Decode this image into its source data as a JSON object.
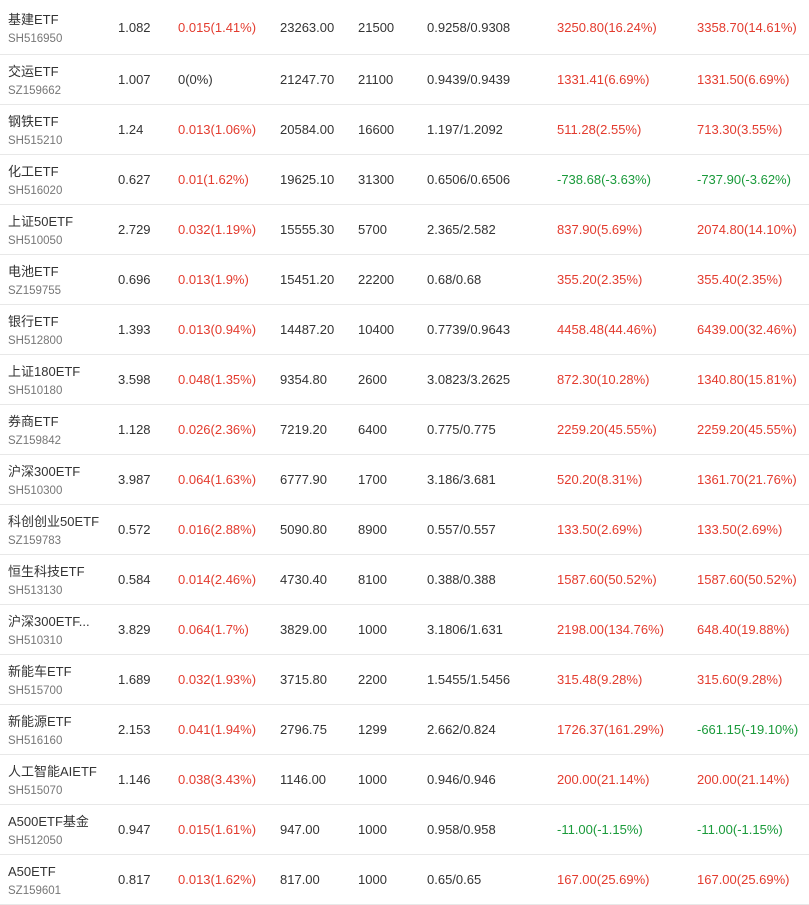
{
  "colors": {
    "up": "#e33b2e",
    "down": "#1a9a3a",
    "flat": "#333333"
  },
  "rows": [
    {
      "name": "基建ETF",
      "code": "SH516950",
      "price": "1.082",
      "change": "0.015(1.41%)",
      "change_dir": "up",
      "market_value": "23263.00",
      "qty": "21500",
      "cost": "0.9258/0.9308",
      "pnl1": "3250.80(16.24%)",
      "pnl1_dir": "up",
      "pnl2": "3358.70(14.61%)",
      "pnl2_dir": "up"
    },
    {
      "name": "交运ETF",
      "code": "SZ159662",
      "price": "1.007",
      "change": "0(0%)",
      "change_dir": "flat",
      "market_value": "21247.70",
      "qty": "21100",
      "cost": "0.9439/0.9439",
      "pnl1": "1331.41(6.69%)",
      "pnl1_dir": "up",
      "pnl2": "1331.50(6.69%)",
      "pnl2_dir": "up"
    },
    {
      "name": "钢铁ETF",
      "code": "SH515210",
      "price": "1.24",
      "change": "0.013(1.06%)",
      "change_dir": "up",
      "market_value": "20584.00",
      "qty": "16600",
      "cost": "1.197/1.2092",
      "pnl1": "511.28(2.55%)",
      "pnl1_dir": "up",
      "pnl2": "713.30(3.55%)",
      "pnl2_dir": "up"
    },
    {
      "name": "化工ETF",
      "code": "SH516020",
      "price": "0.627",
      "change": "0.01(1.62%)",
      "change_dir": "up",
      "market_value": "19625.10",
      "qty": "31300",
      "cost": "0.6506/0.6506",
      "pnl1": "-738.68(-3.63%)",
      "pnl1_dir": "down",
      "pnl2": "-737.90(-3.62%)",
      "pnl2_dir": "down"
    },
    {
      "name": "上证50ETF",
      "code": "SH510050",
      "price": "2.729",
      "change": "0.032(1.19%)",
      "change_dir": "up",
      "market_value": "15555.30",
      "qty": "5700",
      "cost": "2.365/2.582",
      "pnl1": "837.90(5.69%)",
      "pnl1_dir": "up",
      "pnl2": "2074.80(14.10%)",
      "pnl2_dir": "up"
    },
    {
      "name": "电池ETF",
      "code": "SZ159755",
      "price": "0.696",
      "change": "0.013(1.9%)",
      "change_dir": "up",
      "market_value": "15451.20",
      "qty": "22200",
      "cost": "0.68/0.68",
      "pnl1": "355.20(2.35%)",
      "pnl1_dir": "up",
      "pnl2": "355.40(2.35%)",
      "pnl2_dir": "up"
    },
    {
      "name": "银行ETF",
      "code": "SH512800",
      "price": "1.393",
      "change": "0.013(0.94%)",
      "change_dir": "up",
      "market_value": "14487.20",
      "qty": "10400",
      "cost": "0.7739/0.9643",
      "pnl1": "4458.48(44.46%)",
      "pnl1_dir": "up",
      "pnl2": "6439.00(32.46%)",
      "pnl2_dir": "up"
    },
    {
      "name": "上证180ETF",
      "code": "SH510180",
      "price": "3.598",
      "change": "0.048(1.35%)",
      "change_dir": "up",
      "market_value": "9354.80",
      "qty": "2600",
      "cost": "3.0823/3.2625",
      "pnl1": "872.30(10.28%)",
      "pnl1_dir": "up",
      "pnl2": "1340.80(15.81%)",
      "pnl2_dir": "up"
    },
    {
      "name": "券商ETF",
      "code": "SZ159842",
      "price": "1.128",
      "change": "0.026(2.36%)",
      "change_dir": "up",
      "market_value": "7219.20",
      "qty": "6400",
      "cost": "0.775/0.775",
      "pnl1": "2259.20(45.55%)",
      "pnl1_dir": "up",
      "pnl2": "2259.20(45.55%)",
      "pnl2_dir": "up"
    },
    {
      "name": "沪深300ETF",
      "code": "SH510300",
      "price": "3.987",
      "change": "0.064(1.63%)",
      "change_dir": "up",
      "market_value": "6777.90",
      "qty": "1700",
      "cost": "3.186/3.681",
      "pnl1": "520.20(8.31%)",
      "pnl1_dir": "up",
      "pnl2": "1361.70(21.76%)",
      "pnl2_dir": "up"
    },
    {
      "name": "科创创业50ETF",
      "code": "SZ159783",
      "price": "0.572",
      "change": "0.016(2.88%)",
      "change_dir": "up",
      "market_value": "5090.80",
      "qty": "8900",
      "cost": "0.557/0.557",
      "pnl1": "133.50(2.69%)",
      "pnl1_dir": "up",
      "pnl2": "133.50(2.69%)",
      "pnl2_dir": "up"
    },
    {
      "name": "恒生科技ETF",
      "code": "SH513130",
      "price": "0.584",
      "change": "0.014(2.46%)",
      "change_dir": "up",
      "market_value": "4730.40",
      "qty": "8100",
      "cost": "0.388/0.388",
      "pnl1": "1587.60(50.52%)",
      "pnl1_dir": "up",
      "pnl2": "1587.60(50.52%)",
      "pnl2_dir": "up"
    },
    {
      "name": "沪深300ETF...",
      "code": "SH510310",
      "price": "3.829",
      "change": "0.064(1.7%)",
      "change_dir": "up",
      "market_value": "3829.00",
      "qty": "1000",
      "cost": "3.1806/1.631",
      "pnl1": "2198.00(134.76%)",
      "pnl1_dir": "up",
      "pnl2": "648.40(19.88%)",
      "pnl2_dir": "up"
    },
    {
      "name": "新能车ETF",
      "code": "SH515700",
      "price": "1.689",
      "change": "0.032(1.93%)",
      "change_dir": "up",
      "market_value": "3715.80",
      "qty": "2200",
      "cost": "1.5455/1.5456",
      "pnl1": "315.48(9.28%)",
      "pnl1_dir": "up",
      "pnl2": "315.60(9.28%)",
      "pnl2_dir": "up"
    },
    {
      "name": "新能源ETF",
      "code": "SH516160",
      "price": "2.153",
      "change": "0.041(1.94%)",
      "change_dir": "up",
      "market_value": "2796.75",
      "qty": "1299",
      "cost": "2.662/0.824",
      "pnl1": "1726.37(161.29%)",
      "pnl1_dir": "up",
      "pnl2": "-661.15(-19.10%)",
      "pnl2_dir": "down"
    },
    {
      "name": "人工智能AIETF",
      "code": "SH515070",
      "price": "1.146",
      "change": "0.038(3.43%)",
      "change_dir": "up",
      "market_value": "1146.00",
      "qty": "1000",
      "cost": "0.946/0.946",
      "pnl1": "200.00(21.14%)",
      "pnl1_dir": "up",
      "pnl2": "200.00(21.14%)",
      "pnl2_dir": "up"
    },
    {
      "name": "A500ETF基金",
      "code": "SH512050",
      "price": "0.947",
      "change": "0.015(1.61%)",
      "change_dir": "up",
      "market_value": "947.00",
      "qty": "1000",
      "cost": "0.958/0.958",
      "pnl1": "-11.00(-1.15%)",
      "pnl1_dir": "down",
      "pnl2": "-11.00(-1.15%)",
      "pnl2_dir": "down"
    },
    {
      "name": "A50ETF",
      "code": "SZ159601",
      "price": "0.817",
      "change": "0.013(1.62%)",
      "change_dir": "up",
      "market_value": "817.00",
      "qty": "1000",
      "cost": "0.65/0.65",
      "pnl1": "167.00(25.69%)",
      "pnl1_dir": "up",
      "pnl2": "167.00(25.69%)",
      "pnl2_dir": "up"
    }
  ]
}
